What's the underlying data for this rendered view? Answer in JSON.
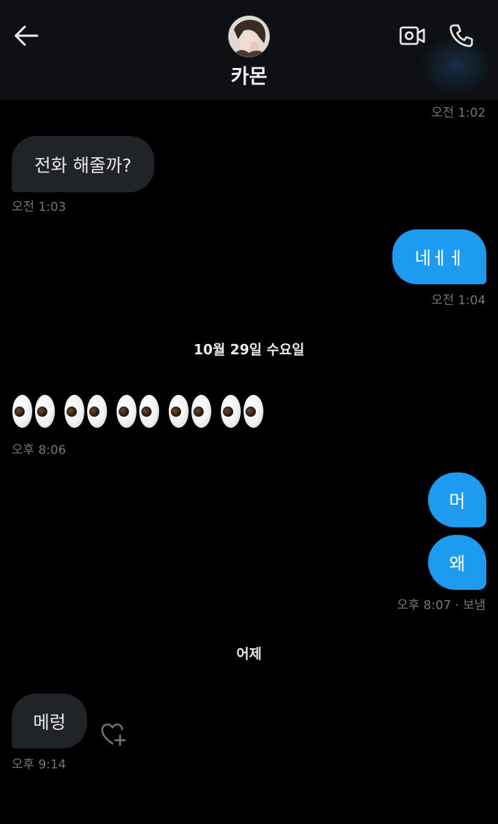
{
  "header": {
    "contact_name": "카몬",
    "icons": {
      "back": "arrow-left-icon",
      "video": "video-camera-icon",
      "call": "phone-icon"
    }
  },
  "messages": {
    "ts_0102": "오전 1:02",
    "m1_text": "전화 해줄까?",
    "m1_time": "오전 1:03",
    "m2_text": "네ㅔㅔ",
    "m2_time": "오전 1:04",
    "date_sep_1": "10월 29일 수요일",
    "m3_emoji": "👀👀👀👀👀",
    "m3_time": "오후 8:06",
    "m4_text": "머",
    "m5_text": "왜",
    "m5_time": "오후 8:07 · 보냄",
    "date_sep_2": "어제",
    "m6_text": "메렁",
    "m6_time": "오후 9:14",
    "react_icon": "heart-plus-icon"
  },
  "colors": {
    "accent": "#1d9bf0",
    "incoming_bubble": "#202327",
    "background": "#000000",
    "header_bg": "#0e1013",
    "timestamp": "#71767b"
  }
}
